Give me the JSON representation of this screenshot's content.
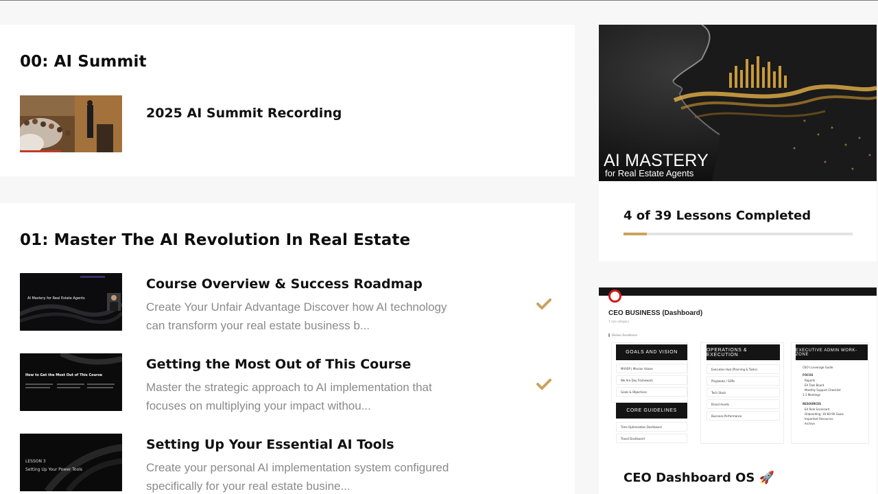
{
  "sections": [
    {
      "title": "00: AI Summit",
      "lessons": [
        {
          "title": "2025 AI Summit Recording",
          "description": "",
          "completed": false
        }
      ]
    },
    {
      "title": "01: Master The AI Revolution In Real Estate",
      "lessons": [
        {
          "title": "Course Overview & Success Roadmap",
          "description": "Create Your Unfair Advantage Discover how AI technology can transform your real estate business b...",
          "completed": true,
          "thumb": {
            "heading": "AI Mastery for Real Estate Agents"
          }
        },
        {
          "title": "Getting the Most Out of This Course",
          "description": "Master the strategic approach to AI implementation that focuses on multiplying your impact withou...",
          "completed": true,
          "thumb": {
            "heading": "How to Get the Most Out of This Course"
          }
        },
        {
          "title": "Setting Up Your Essential AI Tools",
          "description": "Create your personal AI implementation system configured specifically for your real estate busine...",
          "completed": false,
          "thumb": {
            "lesson": "LESSON 3",
            "heading": "Setting Up Your Power Tools"
          }
        }
      ]
    }
  ],
  "course_card": {
    "hero_title": "AI MASTERY",
    "hero_subtitle": "for Real Estate Agents",
    "progress_text": "4 of 39 Lessons Completed",
    "progress_fraction": 0.1026,
    "accent_color": "#c9a35b",
    "check_color": "#c9a35b"
  },
  "dashboard_card": {
    "label": "CEO Dashboard OS 🚀",
    "preview": {
      "title": "CEO BUSINESS (Dashboard)",
      "subtitle": "1 sub-category",
      "banner": "Deliver Excellence",
      "columns": [
        {
          "heading": "GOALS AND VISION",
          "items": [
            "MVVSP | Mission Values",
            "We Are Day Framework",
            "Goals & Objectives"
          ]
        },
        {
          "heading": "OPERATIONS & EXECUTION",
          "items": [
            "Execution Hub (Planning & Tasks)",
            "Playbooks / SOPs",
            "Tech Stack",
            "Brand Assets",
            "Business Performance"
          ]
        },
        {
          "heading": "EXECUTIVE ADMIN WORK-ZONE",
          "items": [
            "CEO's Leverage Guide",
            "FOCUS",
            "Reports",
            "EA Task Board",
            "Monthly Support Checklist",
            "1:1 Meetings",
            "RESOURCES",
            "EA Role Scorecard",
            "Onboarding: 30-60-90 Goals",
            "Important Resources",
            "Archive"
          ]
        }
      ],
      "guidelines_heading": "CORE GUIDELINES",
      "guidelines_items": [
        "Time Optimization Dashboard",
        "Travel Dashboard"
      ]
    }
  }
}
